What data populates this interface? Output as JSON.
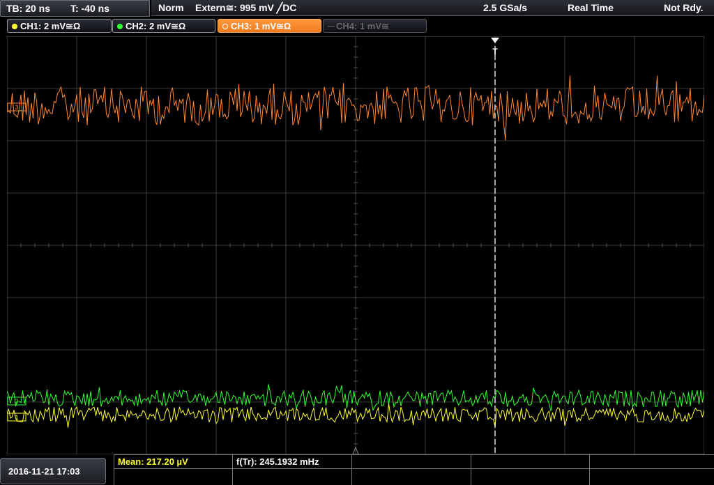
{
  "header": {
    "timebase": "TB: 20 ns",
    "trigger_offset": "T: -40 ns",
    "trigger_mode": "Norm",
    "trigger_source": "Extern≅: 995 mV ╱DC",
    "sample_rate": "2.5 GSa/s",
    "acq_mode": "Real Time",
    "status": "Not Rdy."
  },
  "channels": [
    {
      "label": "CH1: 2 mV≅Ω",
      "color": "#ffff33",
      "active": false,
      "enabled": true
    },
    {
      "label": "CH2: 2 mV≅Ω",
      "color": "#33ff33",
      "active": false,
      "enabled": true
    },
    {
      "label": "CH3: 1 mV≅Ω",
      "color": "#ff8833",
      "active": true,
      "enabled": true
    },
    {
      "label": "CH4: 1 mV≅",
      "color": "#555555",
      "active": false,
      "enabled": false
    }
  ],
  "markers": {
    "ch1": "1",
    "ch2": "2",
    "ch3": "3",
    "trigger": "T"
  },
  "footer": {
    "datetime": "2016-11-21 17:03",
    "meas1": "Mean: 217.20 µV",
    "meas2": "f(Tr): 245.1932 mHz"
  },
  "colors": {
    "ch1": "#ffff33",
    "ch2": "#33ff33",
    "ch3": "#ff8833",
    "grid": "#3a3a3a",
    "meas_yellow": "#ffff33"
  }
}
